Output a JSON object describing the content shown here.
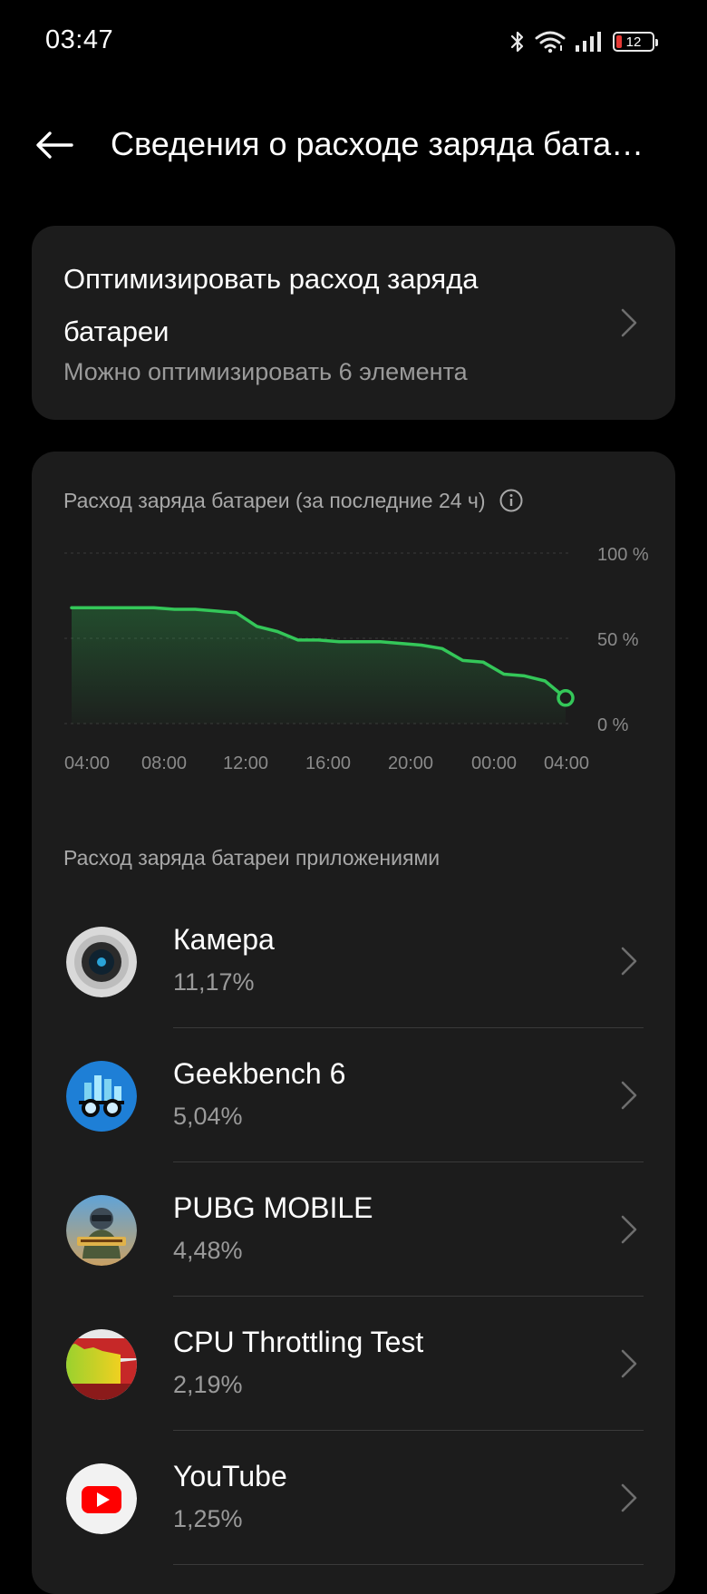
{
  "status_bar": {
    "time": "03:47",
    "battery_level": "12",
    "icons": [
      "bluetooth-icon",
      "wifi-icon",
      "signal-icon",
      "battery-icon"
    ]
  },
  "header": {
    "title": "Сведения о расходе заряда бата…",
    "back_icon": "arrow-left-icon"
  },
  "optimize": {
    "title": "Оптимизировать расход заряда батареи",
    "subtitle": "Можно оптимизировать 6 элемента"
  },
  "chart_section": {
    "title": "Расход заряда батареи (за последние 24 ч)",
    "info_icon": "info-icon"
  },
  "chart_data": {
    "type": "area",
    "x": [
      "04:00",
      "05:00",
      "06:00",
      "07:00",
      "08:00",
      "09:00",
      "10:00",
      "11:00",
      "12:00",
      "13:00",
      "14:00",
      "15:00",
      "16:00",
      "17:00",
      "18:00",
      "19:00",
      "20:00",
      "21:00",
      "22:00",
      "23:00",
      "00:00",
      "01:00",
      "02:00",
      "03:00",
      "03:47"
    ],
    "values": [
      68,
      68,
      68,
      68,
      68,
      67,
      67,
      66,
      65,
      57,
      54,
      49,
      49,
      48,
      48,
      48,
      47,
      46,
      44,
      37,
      36,
      29,
      28,
      25,
      15
    ],
    "xticks": [
      "04:00",
      "08:00",
      "12:00",
      "16:00",
      "20:00",
      "00:00",
      "04:00"
    ],
    "yticks": [
      "100 %",
      "50 %",
      "0 %"
    ],
    "ylim": [
      0,
      100
    ],
    "line_color": "#34c759",
    "grid": true
  },
  "apps_section": {
    "title": "Расход заряда батареи приложениями"
  },
  "apps": [
    {
      "name": "Камера",
      "percent": "11,17%",
      "icon": "camera-app-icon"
    },
    {
      "name": "Geekbench 6",
      "percent": "5,04%",
      "icon": "geekbench-app-icon"
    },
    {
      "name": "PUBG MOBILE",
      "percent": "4,48%",
      "icon": "pubg-app-icon"
    },
    {
      "name": "CPU Throttling Test",
      "percent": "2,19%",
      "icon": "cpu-throttling-app-icon"
    },
    {
      "name": "YouTube",
      "percent": "1,25%",
      "icon": "youtube-app-icon"
    }
  ]
}
